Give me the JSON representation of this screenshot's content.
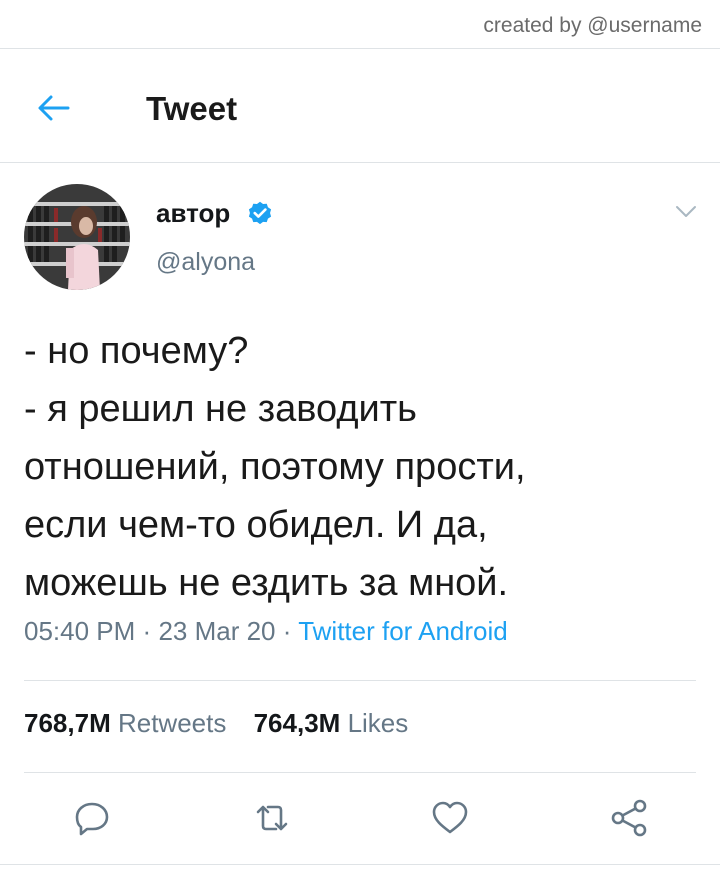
{
  "watermark": "created by @username",
  "header": {
    "title": "Tweet",
    "back_icon": "arrow-left-icon"
  },
  "colors": {
    "accent": "#1da1f2",
    "secondary_text": "#657786",
    "primary_text": "#14171a",
    "divider": "#dfe3e6"
  },
  "tweet": {
    "author_name": "автор",
    "handle": "@alyona",
    "verified": true,
    "text_lines": [
      "- но почему?",
      "- я решил не заводить",
      "отношений, поэтому прости,",
      "если чем-то обидел. И да,",
      "можешь не ездить за мной."
    ],
    "time": "05:40 PM",
    "date": "23 Mar 20",
    "separator": "·",
    "source": "Twitter for Android"
  },
  "stats": {
    "retweets_count": "768,7M",
    "retweets_label": "Retweets",
    "likes_count": "764,3M",
    "likes_label": "Likes"
  },
  "actions": [
    "reply-icon",
    "retweet-icon",
    "like-icon",
    "share-icon"
  ]
}
